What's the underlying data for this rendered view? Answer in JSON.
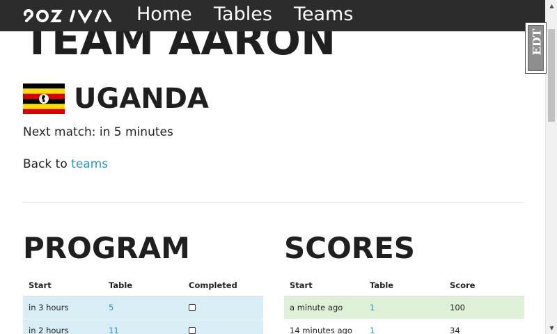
{
  "nav": {
    "logo_name": "logo",
    "links": [
      "Home",
      "Tables",
      "Teams"
    ]
  },
  "team": {
    "title": "TEAM AARON",
    "country": "UGANDA",
    "flag_colors": [
      "#000000",
      "#fcdc04",
      "#d90000"
    ],
    "next_match": "Next match: in 5 minutes",
    "back_prefix": "Back to ",
    "back_link": "teams"
  },
  "program": {
    "title": "PROGRAM",
    "headers": [
      "Start",
      "Table",
      "Completed"
    ],
    "rows": [
      {
        "start": "in 3 hours",
        "table": "5",
        "completed": false
      },
      {
        "start": "in 2 hours",
        "table": "11",
        "completed": false
      }
    ]
  },
  "scores": {
    "title": "SCORES",
    "headers": [
      "Start",
      "Table",
      "Score"
    ],
    "rows": [
      {
        "start": "a minute ago",
        "table": "1",
        "score": "100"
      },
      {
        "start": "14 minutes ago",
        "table": "1",
        "score": "34"
      }
    ]
  },
  "edit_badge": "EDT",
  "colors": {
    "navbar": "#2c2c2c",
    "link": "#2a97b6",
    "info_row": "#d9edf7",
    "success_row": "#dff0d8"
  }
}
